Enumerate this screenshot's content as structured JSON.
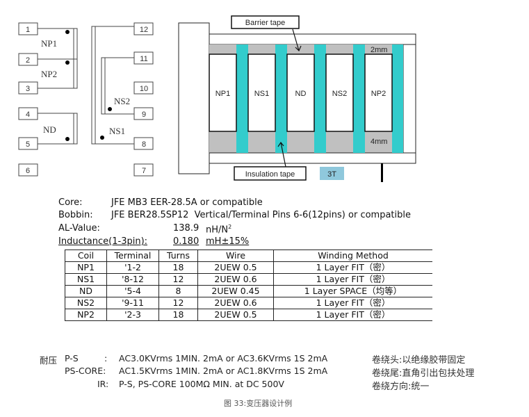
{
  "schematic": {
    "left_pins": [
      "1",
      "2",
      "3",
      "4",
      "5",
      "6"
    ],
    "right_pins": [
      "12",
      "11",
      "10",
      "9",
      "8",
      "7"
    ],
    "winding_labels": {
      "np1": "NP1",
      "np2": "NP2",
      "nd": "ND",
      "ns2": "NS2",
      "ns1": "NS1"
    }
  },
  "structure": {
    "coils": [
      "NP1",
      "NS1",
      "ND",
      "NS2",
      "NP2"
    ],
    "barrier_tape_label": "Barrier tape",
    "insulation_tape_label": "Insulation tape",
    "insulation_turns": "3T",
    "top_margin": "2mm",
    "bottom_margin": "4mm",
    "colors": {
      "insulation_tape": "#33cccc",
      "barrier_tape": "#c0c0c0",
      "legend_3t": "#8fc8dc"
    }
  },
  "specs": {
    "core_label": "Core:",
    "core_value": "JFE MB3 EER-28.5A or compatible",
    "bobbin_label": "Bobbin:",
    "bobbin_value": "JFE BER28.5SP12  Vertical/Terminal Pins 6-6(12pins) or compatible",
    "al_label": "AL-Value:",
    "al_value": "138.9",
    "al_unit": "nH/N",
    "al_unit_sup": "2",
    "inductance_label": "Inductance(1-3pin):",
    "inductance_value": "0.180",
    "inductance_unit": "mH±15%"
  },
  "table": {
    "headers": [
      "Coil",
      "Terminal",
      "Turns",
      "Wire",
      "Winding Method"
    ],
    "rows": [
      [
        "NP1",
        "'1-2",
        "18",
        "2UEW 0.5",
        "1 Layer  FIT（密）"
      ],
      [
        "NS1",
        "'8-12",
        "12",
        "2UEW 0.6",
        "1 Layer  FIT（密）"
      ],
      [
        "ND",
        "'5-4",
        "8",
        "2UEW 0.45",
        "1 Layer  SPACE（均等）"
      ],
      [
        "NS2",
        "'9-11",
        "12",
        "2UEW 0.6",
        "1 Layer  FIT（密）"
      ],
      [
        "NP2",
        "'2-3",
        "18",
        "2UEW 0.5",
        "1 Layer  FIT（密）"
      ]
    ]
  },
  "hipot": {
    "title": "耐压",
    "ps_label": "P-S",
    "ps_colon": ":",
    "ps_value": "AC3.0KVrms  1MIN. 2mA or AC3.6KVrms 1S 2mA",
    "pscore_label": "PS-CORE:",
    "pscore_value": "AC1.5KVrms  1MIN. 2mA or AC1.8KVrms 1S 2mA",
    "ir_label": "IR:",
    "ir_value": "P-S, PS-CORE 100MΩ MIN. at DC 500V"
  },
  "notes": [
    "卷绕头:以绝缘胶带固定",
    "卷绕尾:直角引出包扶处理",
    "卷绕方向:统一"
  ],
  "caption": "图 33:变压器设计例"
}
